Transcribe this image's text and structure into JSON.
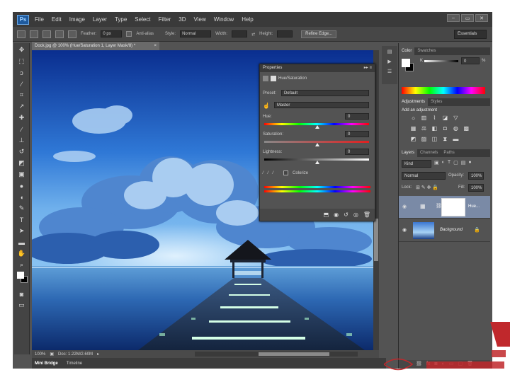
{
  "app": {
    "logo": "Ps",
    "window_buttons": [
      "‒",
      "▭",
      "✕"
    ]
  },
  "menu": [
    "File",
    "Edit",
    "Image",
    "Layer",
    "Type",
    "Select",
    "Filter",
    "3D",
    "View",
    "Window",
    "Help"
  ],
  "options": {
    "feather_label": "Feather:",
    "feather_value": "0 px",
    "antialias_label": "Anti-alias",
    "style_label": "Style:",
    "style_value": "Normal",
    "width_label": "Width:",
    "height_label": "Height:",
    "refine_button": "Refine Edge...",
    "workspace": "Essentials"
  },
  "document": {
    "tab_title": "Dock.jpg @ 100% (Hue/Saturation 1, Layer Mask/8) *",
    "zoom": "100%",
    "doc_size": "Doc: 1.22M/2.60M"
  },
  "bottom_tabs": [
    "Mini Bridge",
    "Timeline"
  ],
  "properties": {
    "title": "Properties",
    "subtitle": "Hue/Saturation",
    "preset_label": "Preset:",
    "preset_value": "Default",
    "channel_value": "Master",
    "hue_label": "Hue:",
    "hue_value": "0",
    "saturation_label": "Saturation:",
    "saturation_value": "0",
    "lightness_label": "Lightness:",
    "lightness_value": "0",
    "colorize_label": "Colorize"
  },
  "color_panel": {
    "tabs": [
      "Color",
      "Swatches"
    ],
    "k_label": "K",
    "k_value": "0",
    "percent": "%"
  },
  "adjustments_panel": {
    "tabs": [
      "Adjustments",
      "Styles"
    ],
    "heading": "Add an adjustment"
  },
  "layers_panel": {
    "tabs": [
      "Layers",
      "Channels",
      "Paths"
    ],
    "kind_value": "Kind",
    "blend_value": "Normal",
    "opacity_label": "Opacity:",
    "opacity_value": "100%",
    "lock_label": "Lock:",
    "fill_label": "Fill:",
    "fill_value": "100%",
    "layers": [
      {
        "name": "Hue..."
      },
      {
        "name": "Background"
      }
    ]
  },
  "colors": {
    "accent": "#1e5a9e",
    "panel_bg": "#535353",
    "menubar_bg": "#3a3a3a"
  }
}
